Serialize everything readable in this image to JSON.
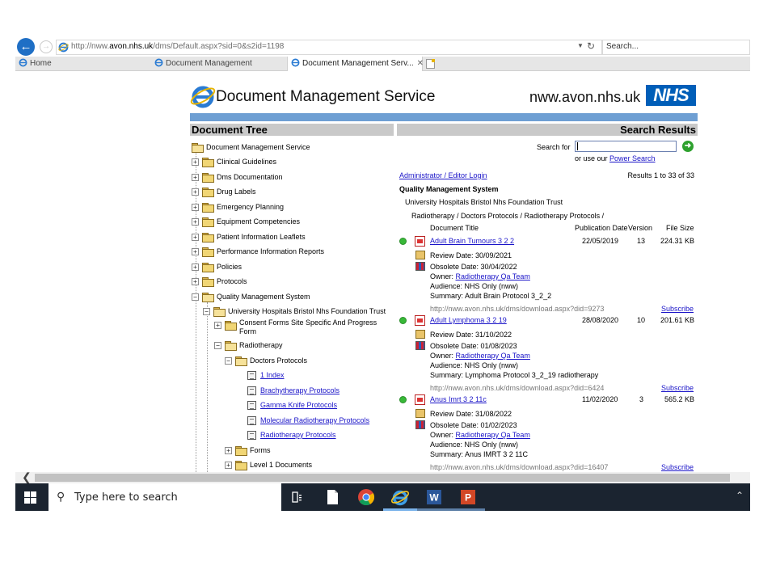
{
  "browser": {
    "url_prefix": "http://nww.",
    "url_domain": "avon.nhs.uk",
    "url_rest": "/dms/Default.aspx?sid=0&s2id=1198",
    "search_placeholder": "Search...",
    "tabs": [
      {
        "label": "Home"
      },
      {
        "label": "Document Management"
      },
      {
        "label": "Document Management Serv..."
      }
    ]
  },
  "header": {
    "title": "Document Management Service",
    "domain": "nww.avon.nhs.uk",
    "nhs_logo": "NHS"
  },
  "tree": {
    "heading": "Document Tree",
    "root": "Document Management Service",
    "items": [
      "Clinical Guidelines",
      "Dms Documentation",
      "Drug Labels",
      "Emergency Planning",
      "Equipment Competencies",
      "Patient Information Leaflets",
      "Performance Information Reports",
      "Policies",
      "Protocols",
      "Quality Management System"
    ],
    "trust": "University Hospitals Bristol Nhs Foundation Trust",
    "consent": "Consent Forms Site Specific And Progress Form",
    "radiotherapy": "Radiotherapy",
    "doctors": "Doctors Protocols",
    "docs": [
      "1 Index",
      "Brachytherapy Protocols",
      "Gamma Knife Protocols",
      "Molecular Radiotherapy Protocols",
      "Radiotherapy Protocols"
    ],
    "forms": "Forms",
    "level1": "Level 1 Documents",
    "expand_plus": "+",
    "expand_minus": "−"
  },
  "results": {
    "heading": "Search Results",
    "search_label": "Search for",
    "search_value": "",
    "power_prefix": "or use our ",
    "power_link": "Power Search",
    "admin_link": "Administrator / Editor Login",
    "count": "Results 1 to 33 of 33",
    "qms": "Quality Management System",
    "trust": "University Hospitals Bristol Nhs Foundation Trust",
    "breadcrumb": "Radiotherapy / Doctors Protocols / Radiotherapy Protocols /",
    "columns": {
      "title": "Document Title",
      "date": "Publication Date",
      "version": "Version",
      "size": "File Size"
    },
    "items": [
      {
        "title": "Adult Brain Tumours 3 2 2",
        "date": "22/05/2019",
        "version": "13",
        "size": "224.31 KB",
        "review": "Review Date: 30/09/2021",
        "obsolete": "Obsolete Date: 30/04/2022",
        "owner_label": "Owner: ",
        "owner": "Radiotherapy Qa Team",
        "audience": "Audience: NHS Only (nww)",
        "summary": "Summary: Adult Brain Protocol 3_2_2",
        "url": "http://nww.avon.nhs.uk/dms/download.aspx?did=9273",
        "subscribe": "Subscribe"
      },
      {
        "title": "Adult Lymphoma 3 2 19",
        "date": "28/08/2020",
        "version": "10",
        "size": "201.61 KB",
        "review": "Review Date: 31/10/2022",
        "obsolete": "Obsolete Date: 01/08/2023",
        "owner_label": "Owner: ",
        "owner": "Radiotherapy Qa Team",
        "audience": "Audience: NHS Only (nww)",
        "summary": "Summary: Lymphoma Protocol 3_2_19 radiotherapy",
        "url": "http://nww.avon.nhs.uk/dms/download.aspx?did=6424",
        "subscribe": "Subscribe"
      },
      {
        "title": "Anus Imrt 3 2 11c",
        "date": "11/02/2020",
        "version": "3",
        "size": "565.2 KB",
        "review": "Review Date: 31/08/2022",
        "obsolete": "Obsolete Date: 01/02/2023",
        "owner_label": "Owner: ",
        "owner": "Radiotherapy Qa Team",
        "audience": "Audience: NHS Only (nww)",
        "summary": "Summary: Anus IMRT 3 2 11C",
        "url": "http://nww.avon.nhs.uk/dms/download.aspx?did=16407",
        "subscribe": "Subscribe"
      }
    ]
  },
  "taskbar": {
    "search_placeholder": "Type here to search",
    "apps": [
      "task-view-icon",
      "file-explorer-icon",
      "chrome-icon",
      "internet-explorer-icon",
      "word-icon",
      "powerpoint-icon"
    ]
  },
  "colors": {
    "nhs_blue": "#005eb8",
    "header_bar": "#6e9fd3",
    "link": "#1a14c8",
    "taskbar": "#1b2430"
  }
}
